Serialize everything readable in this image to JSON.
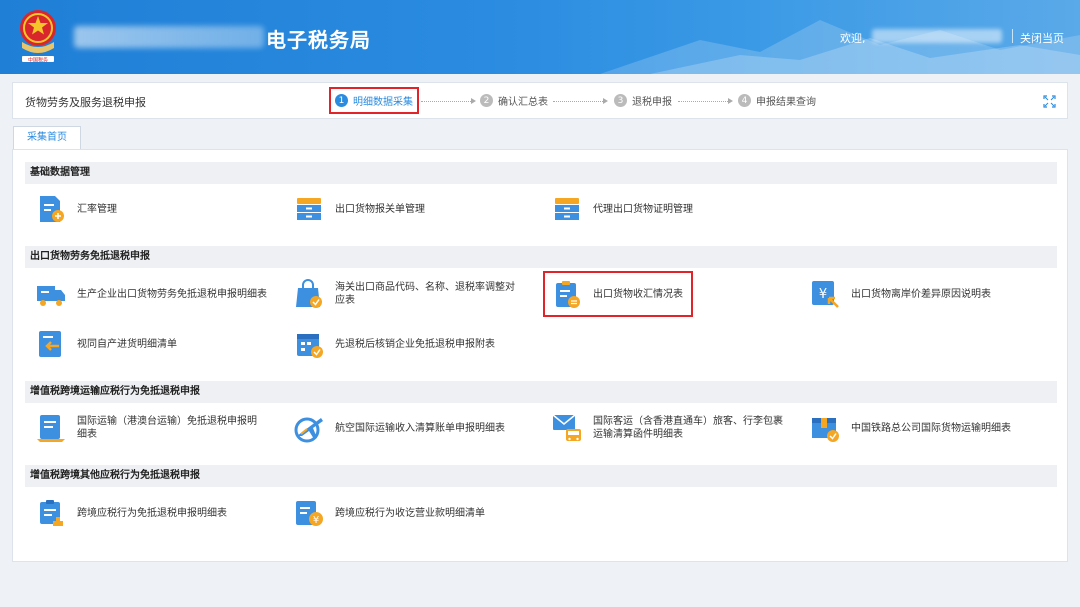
{
  "header": {
    "site_title": "电子税务局",
    "welcome": "欢迎,",
    "close_page": "关闭当页"
  },
  "steps_bar": {
    "page_name": "货物劳务及服务退税申报",
    "steps": [
      {
        "num": "1",
        "label": "明细数据采集",
        "active": true
      },
      {
        "num": "2",
        "label": "确认汇总表",
        "active": false
      },
      {
        "num": "3",
        "label": "退税申报",
        "active": false
      },
      {
        "num": "4",
        "label": "申报结果查询",
        "active": false
      }
    ]
  },
  "tab": {
    "label": "采集首页"
  },
  "sections": [
    {
      "title": "基础数据管理",
      "items": [
        "汇率管理",
        "出口货物报关单管理",
        "代理出口货物证明管理"
      ]
    },
    {
      "title": "出口货物劳务免抵退税申报",
      "items": [
        "生产企业出口货物劳务免抵退税申报明细表",
        "海关出口商品代码、名称、退税率调整对应表",
        "出口货物收汇情况表",
        "出口货物离岸价差异原因说明表",
        "视同自产进货明细清单",
        "先退税后核销企业免抵退税申报附表"
      ]
    },
    {
      "title": "增值税跨境运输应税行为免抵退税申报",
      "items": [
        "国际运输（港澳台运输）免抵退税申报明细表",
        "航空国际运输收入清算账单申报明细表",
        "国际客运（含香港直通车）旅客、行李包裹运输清算函件明细表",
        "中国铁路总公司国际货物运输明细表"
      ]
    },
    {
      "title": "增值税跨境其他应税行为免抵退税申报",
      "items": [
        "跨境应税行为免抵退税申报明细表",
        "跨境应税行为收讫营业款明细清单"
      ]
    }
  ],
  "colors": {
    "accent": "#2a8be0",
    "highlight": "#e0242a",
    "icon_blue": "#3d8fe0",
    "icon_orange": "#f5a623"
  }
}
